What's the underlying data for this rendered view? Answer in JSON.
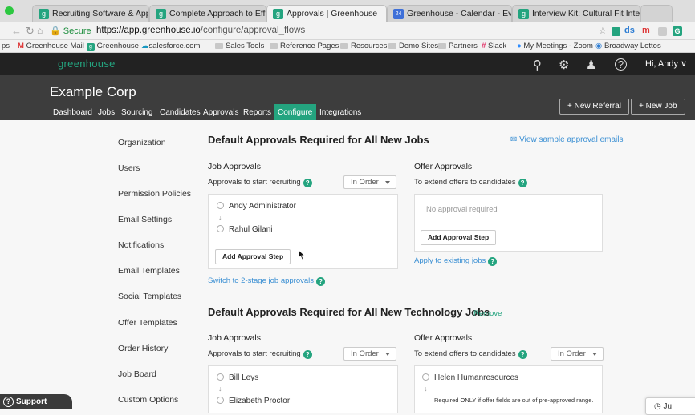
{
  "browser": {
    "tabs": [
      {
        "label": "Recruiting Software & Applica",
        "icon": "greenhouse-favicon"
      },
      {
        "label": "Complete Approach to Effectiv",
        "icon": "greenhouse-favicon"
      },
      {
        "label": "Approvals | Greenhouse",
        "icon": "greenhouse-favicon"
      },
      {
        "label": "Greenhouse - Calendar - Even",
        "icon": "calendar-favicon",
        "badge": "24"
      },
      {
        "label": "Interview Kit: Cultural Fit Interv",
        "icon": "greenhouse-favicon"
      }
    ],
    "secure_label": "Secure",
    "url_scheme_host": "https://app.greenhouse.io",
    "url_path": "/configure/approval_flows",
    "extensions": [
      "ds",
      "m",
      "G"
    ],
    "bookmarks": [
      "ps",
      "Greenhouse Mail",
      "Greenhouse",
      "salesforce.com",
      "Sales Tools",
      "Reference Pages",
      "Resources",
      "Demo Sites",
      "Partners",
      "Slack",
      "My Meetings - Zoom",
      "Broadway Lottos"
    ]
  },
  "header": {
    "logo": "greenhouse",
    "greeting": "Hi, Andy"
  },
  "subheader": {
    "company": "Example Corp",
    "nav": [
      "Dashboard",
      "Jobs",
      "Sourcing",
      "Candidates",
      "Approvals",
      "Reports",
      "Configure",
      "Integrations"
    ],
    "active_nav": "Configure",
    "new_referral": "+ New Referral",
    "new_job": "+ New Job"
  },
  "sidenav": [
    "Organization",
    "Users",
    "Permission Policies",
    "Email Settings",
    "Notifications",
    "Email Templates",
    "Social Templates",
    "Offer Templates",
    "Order History",
    "Job Board",
    "Custom Options"
  ],
  "section1": {
    "title": "Default Approvals Required for All New Jobs",
    "sample_link": "View sample approval emails",
    "job": {
      "label": "Job Approvals",
      "sub": "Approvals to start recruiting",
      "order": "In Order",
      "approvers": [
        "Andy Administrator",
        "Rahul Gilani"
      ],
      "add_step": "Add Approval Step",
      "switch_link": "Switch to 2-stage job approvals"
    },
    "offer": {
      "label": "Offer Approvals",
      "sub": "To extend offers to candidates",
      "none": "No approval required",
      "add_step": "Add Approval Step",
      "apply_link": "Apply to existing jobs"
    }
  },
  "section2": {
    "title": "Default Approvals Required for All New Technology Jobs",
    "remove": "Remove",
    "job": {
      "label": "Job Approvals",
      "sub": "Approvals to start recruiting",
      "order": "In Order",
      "approvers": [
        "Bill Leys",
        "Elizabeth Proctor"
      ]
    },
    "offer": {
      "label": "Offer Approvals",
      "sub": "To extend offers to candidates",
      "order": "In Order",
      "approvers": [
        "Helen Humanresources"
      ],
      "note": "Required ONLY if offer fields are out of pre-approved range."
    }
  },
  "support": "Support",
  "toast": "Ju"
}
